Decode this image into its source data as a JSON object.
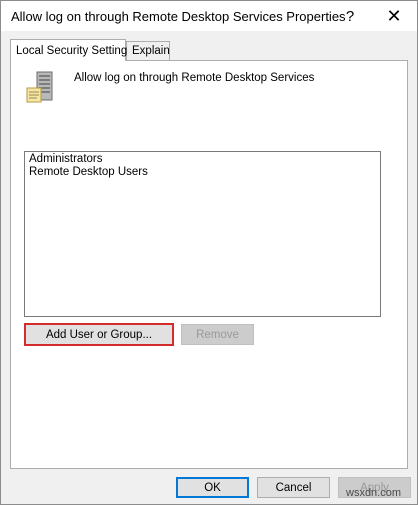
{
  "window": {
    "title": "Allow log on through Remote Desktop Services Properties",
    "help_glyph": "?",
    "close_glyph": "✕"
  },
  "tabs": [
    {
      "label": "Local Security Setting",
      "active": true
    },
    {
      "label": "Explain",
      "active": false
    }
  ],
  "policy": {
    "icon": "server-policy-icon",
    "name": "Allow log on through Remote Desktop Services"
  },
  "members": [
    "Administrators",
    "Remote Desktop Users"
  ],
  "buttons": {
    "add": "Add User or Group...",
    "remove": "Remove",
    "ok": "OK",
    "cancel": "Cancel",
    "apply": "Apply"
  },
  "watermark": "wsxdn.com",
  "colors": {
    "highlight_border": "#d42b2b",
    "default_button_border": "#0078d7"
  }
}
